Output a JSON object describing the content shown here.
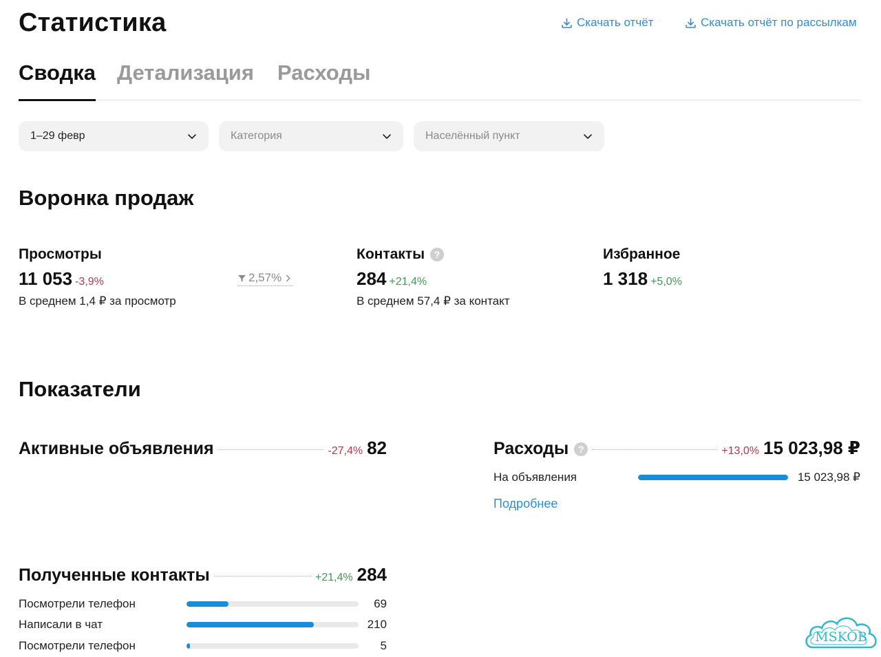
{
  "header": {
    "title": "Статистика",
    "download_report": "Скачать отчёт",
    "download_mailing_report": "Скачать отчёт по рассылкам"
  },
  "tabs": [
    {
      "label": "Сводка",
      "active": true
    },
    {
      "label": "Детализация",
      "active": false
    },
    {
      "label": "Расходы",
      "active": false
    }
  ],
  "filters": {
    "period": "1–29 февр",
    "category_placeholder": "Категория",
    "location_placeholder": "Населённый пункт"
  },
  "funnel": {
    "title": "Воронка продаж",
    "views": {
      "label": "Просмотры",
      "value": "11 053",
      "change": "-3,9%",
      "sub": "В среднем 1,4 ₽ за просмотр",
      "conversion": "2,57%"
    },
    "contacts": {
      "label": "Контакты",
      "value": "284",
      "change": "+21,4%",
      "sub": "В среднем 57,4 ₽ за контакт"
    },
    "favorites": {
      "label": "Избранное",
      "value": "1 318",
      "change": "+5,0%"
    }
  },
  "indicators": {
    "title": "Показатели",
    "active_ads": {
      "label": "Активные объявления",
      "change": "-27,4%",
      "value": "82"
    },
    "expenses": {
      "label": "Расходы",
      "change": "+13,0%",
      "value": "15 023,98 ₽",
      "rows": [
        {
          "label": "На объявления",
          "value": "15 023,98 ₽",
          "fraction": 1.0
        }
      ],
      "more": "Подробнее"
    },
    "contacts": {
      "label": "Полученные контакты",
      "change": "+21,4%",
      "value": "284",
      "rows": [
        {
          "label": "Посмотрели телефон",
          "value": "69",
          "fraction": 0.243
        },
        {
          "label": "Написали в чат",
          "value": "210",
          "fraction": 0.739
        },
        {
          "label": "Посмотрели телефон",
          "value": "5",
          "fraction": 0.018
        }
      ]
    }
  },
  "watermark": {
    "text": "MSKOB"
  },
  "colors": {
    "accent": "#2f8ecc",
    "bar": "#1a8cd8",
    "negative": "#b5394b",
    "positive": "#3f9b54",
    "watermark": "#2fb8c8"
  }
}
